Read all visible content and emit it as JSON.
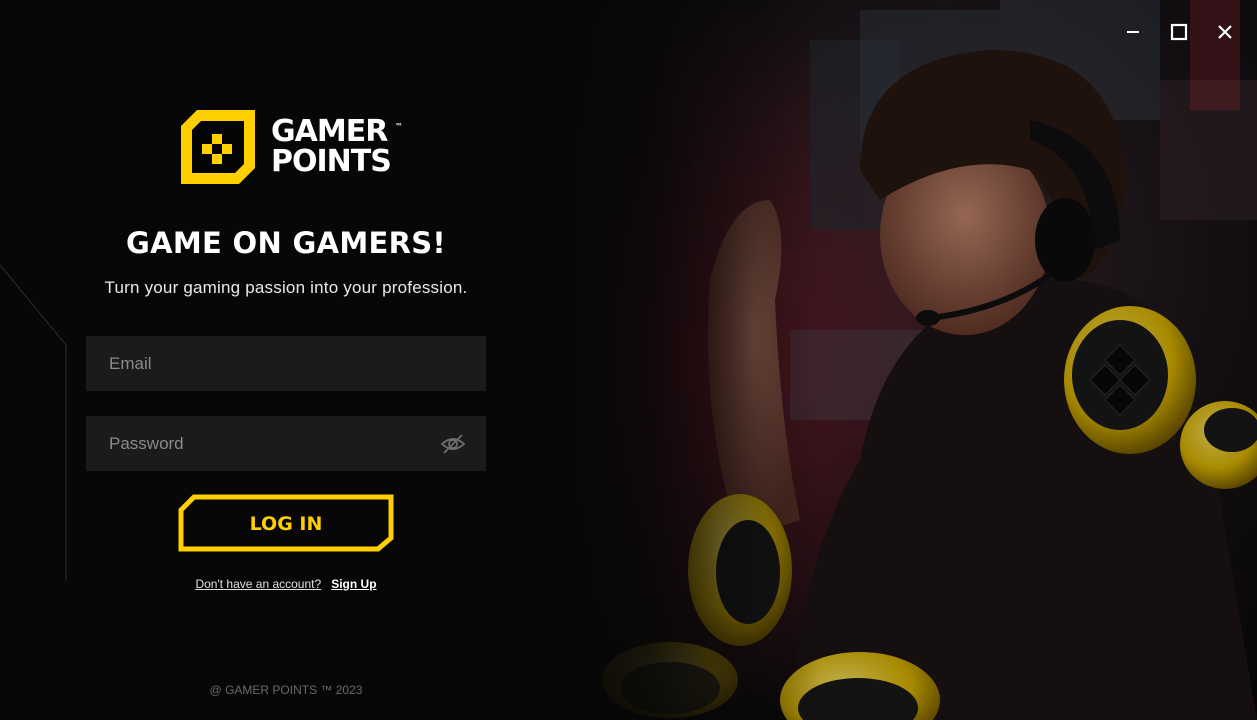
{
  "window": {
    "minimize_icon": "minimize-icon",
    "maximize_icon": "maximize-icon",
    "close_icon": "close-icon"
  },
  "brand": {
    "line1": "GAMER",
    "line2": "POINTS",
    "tm": "™",
    "accent_color": "#ffcf00"
  },
  "hero": {
    "headline": "GAME ON GAMERS!",
    "subline": "Turn your gaming passion into your profession."
  },
  "form": {
    "email_placeholder": "Email",
    "password_placeholder": "Password",
    "password_toggle_icon": "eye-off-icon",
    "login_label": "LOG IN",
    "signup_prompt": "Don't have an account?",
    "signup_link": "Sign Up"
  },
  "footer": {
    "copyright": "@ GAMER POINTS ™ 2023"
  }
}
